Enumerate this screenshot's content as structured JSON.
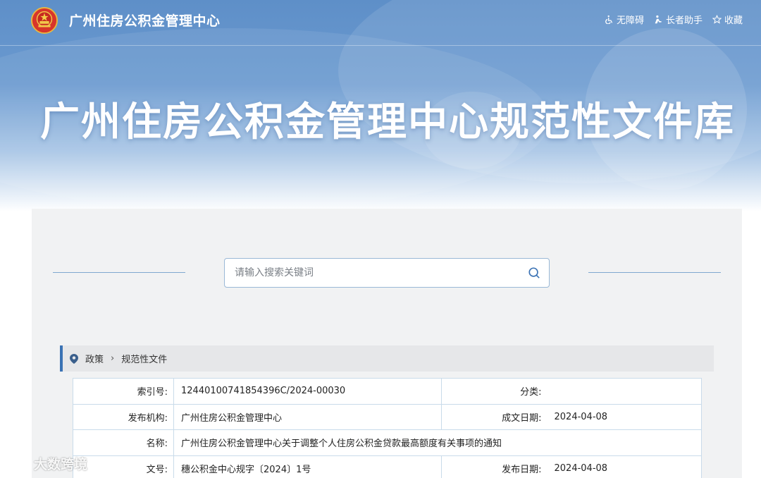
{
  "header": {
    "site_name": "广州住房公积金管理中心",
    "links": [
      {
        "icon": "wheelchair-icon",
        "label": "无障碍"
      },
      {
        "icon": "elder-helper-icon",
        "label": "长者助手"
      },
      {
        "icon": "star-icon",
        "label": "收藏"
      }
    ]
  },
  "banner": {
    "title": "广州住房公积金管理中心规范性文件库"
  },
  "search": {
    "placeholder": "请输入搜索关键词"
  },
  "breadcrumb": {
    "items": [
      "政策",
      "规范性文件"
    ],
    "separator": "›"
  },
  "document_info": {
    "index_no_label": "索引号:",
    "index_no": "12440100741854396C/2024-00030",
    "category_label": "分类:",
    "category": "",
    "publisher_label": "发布机构:",
    "publisher": "广州住房公积金管理中心",
    "created_date_label": "成文日期:",
    "created_date": "2024-04-08",
    "title_label": "名称:",
    "title": "广州住房公积金管理中心关于调整个人住房公积金贷款最高额度有关事项的通知",
    "doc_no_label": "文号:",
    "doc_no": "穗公积金中心规字〔2024〕1号",
    "publish_date_label": "发布日期:",
    "publish_date": "2024-04-08"
  },
  "watermark": {
    "text": "大数跨境"
  },
  "colors": {
    "banner_blue": "#5e8fc8",
    "accent_blue": "#3a72b4",
    "table_border": "#c9dbea",
    "panel_bg": "#f1f2f3"
  }
}
